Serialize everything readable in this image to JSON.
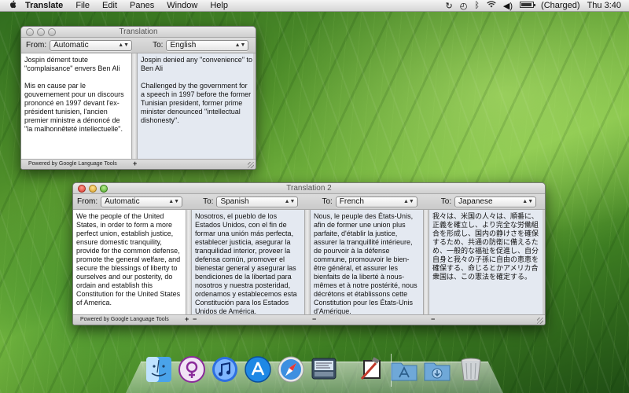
{
  "menubar": {
    "app_name": "Translate",
    "menus": [
      "File",
      "Edit",
      "Panes",
      "Window",
      "Help"
    ],
    "battery_status": "(Charged)",
    "clock": "Thu 3:40"
  },
  "window1": {
    "title": "Translation",
    "from_label": "From:",
    "from_value": "Automatic",
    "to_label": "To:",
    "to_value": "English",
    "source_text": "Jospin dément toute \"complaisance\" envers Ben Ali\n\nMis en cause par le gouvernement pour un discours prononcé en 1997 devant l'ex-président tunisien, l'ancien premier ministre a dénoncé de \"la malhonnêteté intellectuelle\".",
    "target_text": "Jospin denied any \"convenience\" to Ben Ali\n\nChallenged by the government for a speech in 1997 before the former Tunisian president, former prime minister denounced \"intellectual dishonesty\".",
    "powered_by": "Powered by Google Language Tools",
    "add_pane": "+"
  },
  "window2": {
    "title": "Translation 2",
    "from_label": "From:",
    "from_value": "Automatic",
    "to_label": "To:",
    "targets": [
      {
        "language": "Spanish",
        "text": "Nosotros, el pueblo de los Estados Unidos, con el fin de formar una unión más perfecta, establecer justicia, asegurar la tranquilidad interior, proveer la defensa común, promover el bienestar general y asegurar las bendiciones de la libertad para nosotros y nuestra posteridad, ordenamos y establecemos esta Constitución para los Estados Unidos de América."
      },
      {
        "language": "French",
        "text": "Nous, le peuple des États-Unis, afin de former une union plus parfaite, d'établir la justice, assurer la tranquillité intérieure, de pourvoir à la défense commune, promouvoir le bien-être général, et assurer les bienfaits de la liberté à nous-mêmes et à notre postérité, nous décrétons et établissons cette Constitution pour les États-Unis d'Amérique."
      },
      {
        "language": "Japanese",
        "text": "我々は、米国の人々は、順番に、正義を確立し、より完全な労働組合を形成し、国内の静けさを確保するため、共通の防衛に備えるため、一般的な福祉を促進し、自分自身と我々の子孫に自由の恵恵を確保する、命じるとかアメリカ合衆国は、この憲法を確定する。"
      }
    ],
    "source_text": "We the people of the United States, in order to form a more perfect union, establish justice, ensure domestic tranquility, provide for the common defense, promote the general welfare, and secure the blessings of liberty to ourselves and our posterity, do ordain and establish this Constitution for the United States of America.",
    "powered_by": "Powered by Google Language Tools",
    "add_pane": "+",
    "remove_pane": "−"
  },
  "dock": {
    "icons": [
      "finder-icon",
      "audio-converter-icon",
      "itunes-icon",
      "app-store-icon",
      "safari-icon",
      "translate-app-icon",
      "xcode-icon",
      "applications-folder-icon",
      "downloads-folder-icon",
      "trash-icon"
    ]
  }
}
